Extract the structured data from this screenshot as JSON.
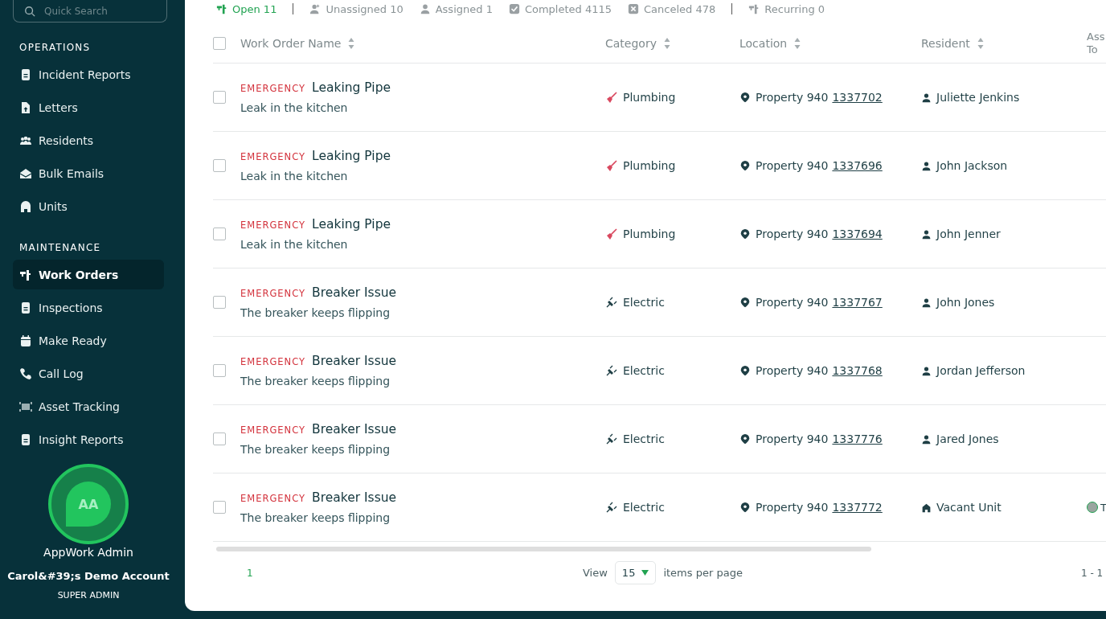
{
  "search": {
    "placeholder": "Quick Search"
  },
  "sidebar": {
    "sections": [
      {
        "title": "OPERATIONS",
        "items": [
          {
            "label": "Incident Reports",
            "kind": "document",
            "selected": false
          },
          {
            "label": "Letters",
            "kind": "letter",
            "selected": false
          },
          {
            "label": "Residents",
            "kind": "people",
            "selected": false
          },
          {
            "label": "Bulk Emails",
            "kind": "email",
            "selected": false
          },
          {
            "label": "Units",
            "kind": "unit",
            "selected": false
          }
        ]
      },
      {
        "title": "MAINTENANCE",
        "items": [
          {
            "label": "Work Orders",
            "kind": "workorder",
            "selected": true
          },
          {
            "label": "Inspections",
            "kind": "document",
            "selected": false
          },
          {
            "label": "Make Ready",
            "kind": "calendar",
            "selected": false
          },
          {
            "label": "Call Log",
            "kind": "phone",
            "selected": false
          },
          {
            "label": "Asset Tracking",
            "kind": "asset",
            "selected": false
          },
          {
            "label": "Insight Reports",
            "kind": "document",
            "selected": false
          }
        ]
      }
    ]
  },
  "user": {
    "initials": "AA",
    "name": "AppWork Admin",
    "account": "Carol&#39;s Demo Account",
    "role": "SUPER ADMIN"
  },
  "filters": [
    {
      "label": "Open 11",
      "kind": "open",
      "selected": true
    },
    {
      "label": "Unassigned 10",
      "kind": "unassigned",
      "selected": false
    },
    {
      "label": "Assigned 1",
      "kind": "assigned",
      "selected": false
    },
    {
      "label": "Completed 4115",
      "kind": "completed",
      "selected": false
    },
    {
      "label": "Canceled 478",
      "kind": "canceled",
      "selected": false
    },
    {
      "label": "Recurring 0",
      "kind": "recurring",
      "selected": false
    }
  ],
  "table": {
    "columns": [
      "Work Order Name",
      "Category",
      "Location",
      "Resident",
      "Ass To"
    ],
    "all_checked": false,
    "rows": [
      {
        "checked": false,
        "priority": "EMERGENCY",
        "title": "Leaking Pipe",
        "description": "Leak in the kitchen",
        "category": {
          "label": "Plumbing",
          "kind": "plumbing"
        },
        "property": "Property 940",
        "unit": "1337702",
        "resident": {
          "name": "Juliette Jenkins",
          "kind": "person"
        }
      },
      {
        "checked": false,
        "priority": "EMERGENCY",
        "title": "Leaking Pipe",
        "description": "Leak in the kitchen",
        "category": {
          "label": "Plumbing",
          "kind": "plumbing"
        },
        "property": "Property 940",
        "unit": "1337696",
        "resident": {
          "name": "John Jackson",
          "kind": "person"
        }
      },
      {
        "checked": false,
        "priority": "EMERGENCY",
        "title": "Leaking Pipe",
        "description": "Leak in the kitchen",
        "category": {
          "label": "Plumbing",
          "kind": "plumbing"
        },
        "property": "Property 940",
        "unit": "1337694",
        "resident": {
          "name": "John Jenner",
          "kind": "person"
        }
      },
      {
        "checked": false,
        "priority": "EMERGENCY",
        "title": "Breaker Issue",
        "description": "The breaker keeps flipping",
        "category": {
          "label": "Electric",
          "kind": "electric"
        },
        "property": "Property 940",
        "unit": "1337767",
        "resident": {
          "name": "John Jones",
          "kind": "person"
        }
      },
      {
        "checked": false,
        "priority": "EMERGENCY",
        "title": "Breaker Issue",
        "description": "The breaker keeps flipping",
        "category": {
          "label": "Electric",
          "kind": "electric"
        },
        "property": "Property 940",
        "unit": "1337768",
        "resident": {
          "name": "Jordan Jefferson",
          "kind": "person"
        }
      },
      {
        "checked": false,
        "priority": "EMERGENCY",
        "title": "Breaker Issue",
        "description": "The breaker keeps flipping",
        "category": {
          "label": "Electric",
          "kind": "electric"
        },
        "property": "Property 940",
        "unit": "1337776",
        "resident": {
          "name": "Jared Jones",
          "kind": "person"
        }
      },
      {
        "checked": false,
        "priority": "EMERGENCY",
        "title": "Breaker Issue",
        "description": "The breaker keeps flipping",
        "category": {
          "label": "Electric",
          "kind": "electric"
        },
        "property": "Property 940",
        "unit": "1337772",
        "resident": {
          "name": "Vacant Unit",
          "kind": "vacant"
        },
        "assignee": "T"
      }
    ]
  },
  "pagination": {
    "page": "1",
    "view_label": "View",
    "per_page": "15",
    "per_page_suffix": "items per page",
    "range": "1 - 1"
  }
}
